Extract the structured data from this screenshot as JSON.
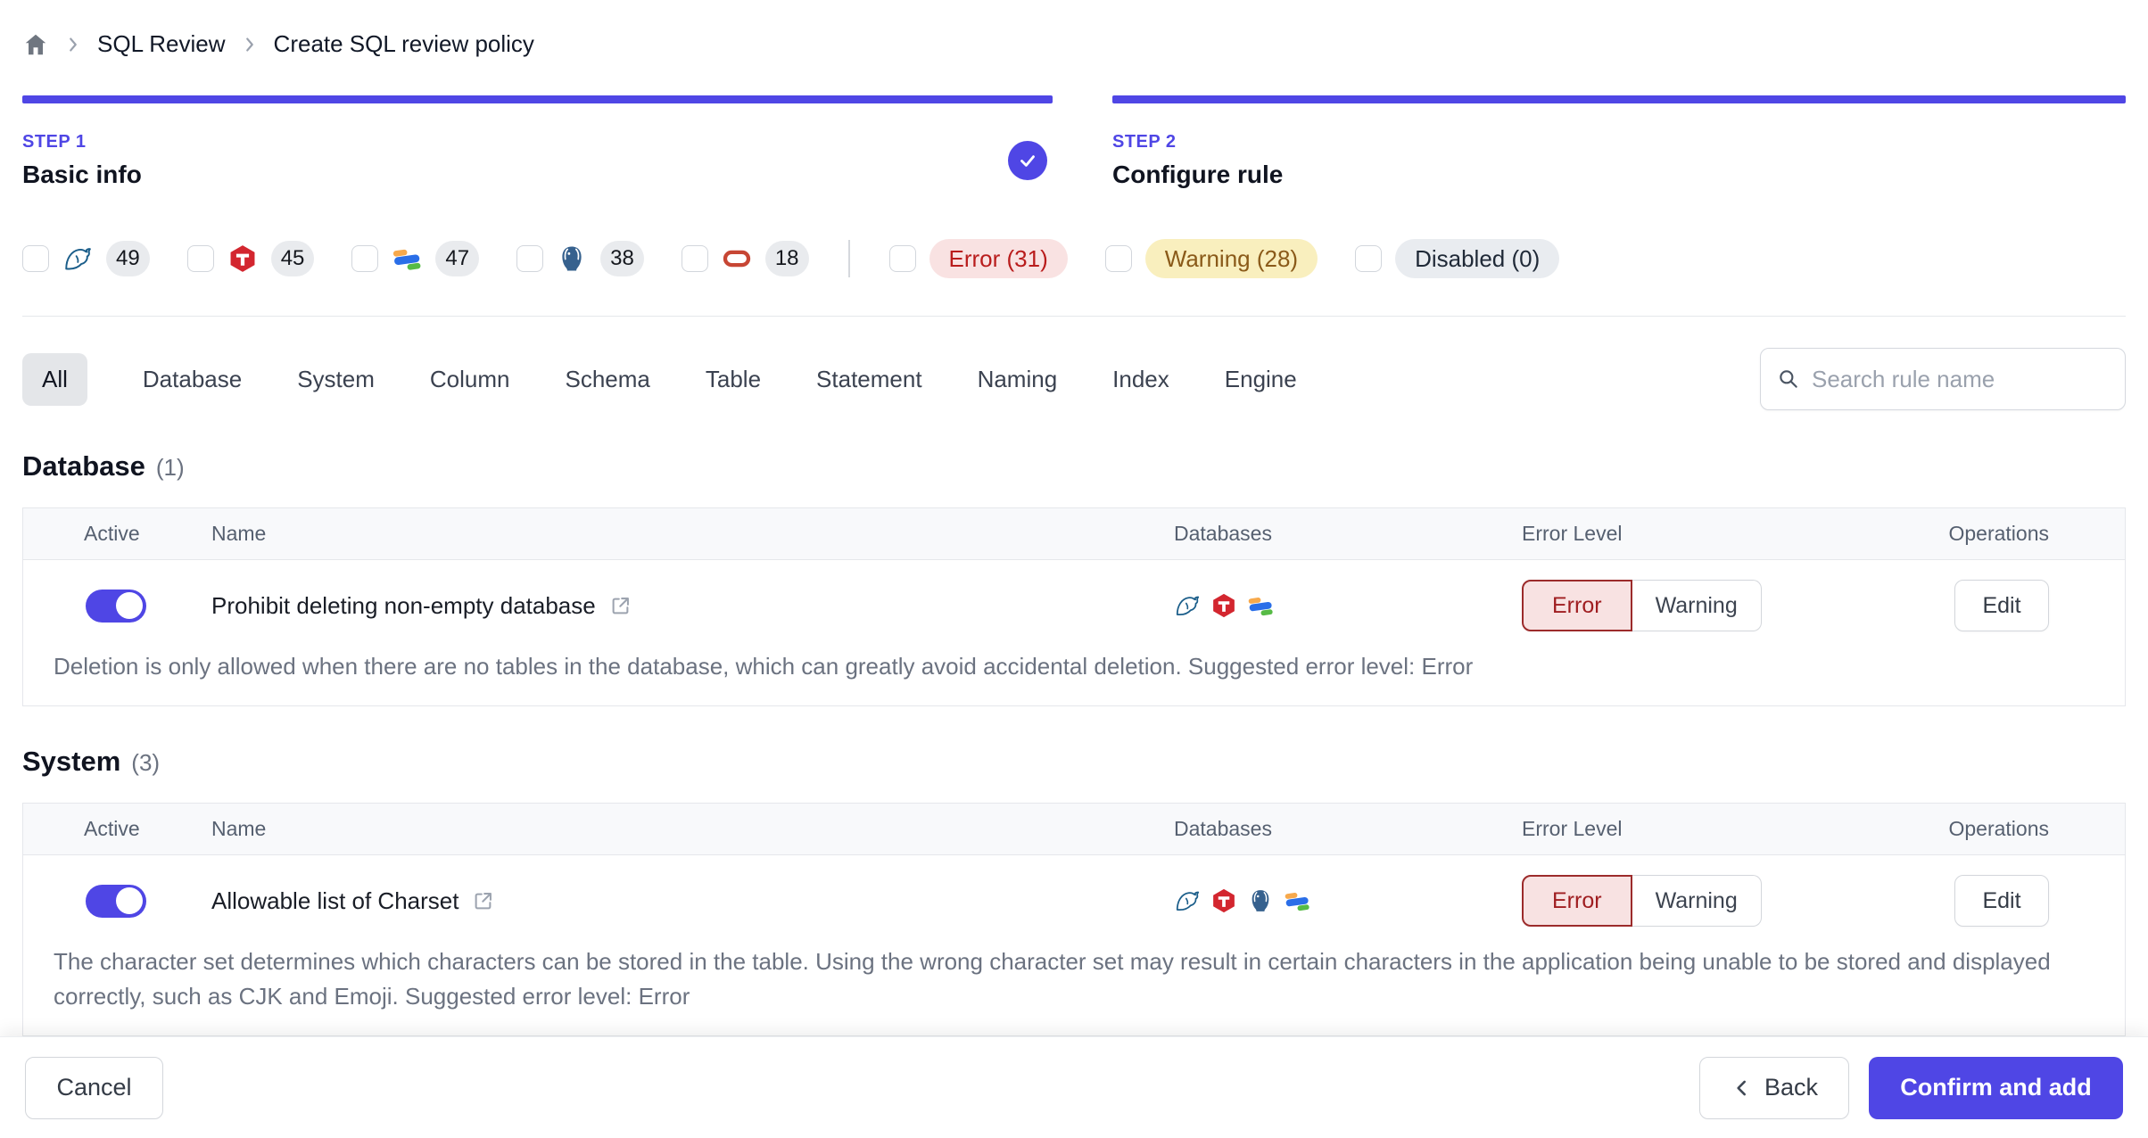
{
  "colors": {
    "accent": "#4f46e5",
    "error_text": "#9f1d20",
    "error_bg": "#f8e2e2",
    "warning_text": "#8a5a19",
    "warning_bg": "#f9efbe",
    "disabled_bg": "#e9ecf0"
  },
  "breadcrumb": {
    "home_icon": "home-icon",
    "items": [
      "SQL Review",
      "Create SQL review policy"
    ]
  },
  "steps": [
    {
      "label": "STEP 1",
      "title": "Basic info",
      "completed": true
    },
    {
      "label": "STEP 2",
      "title": "Configure rule",
      "completed": false
    }
  ],
  "filters": {
    "engines": [
      {
        "icon": "mysql",
        "count": "49"
      },
      {
        "icon": "tidb",
        "count": "45"
      },
      {
        "icon": "oceanbase",
        "count": "47"
      },
      {
        "icon": "postgres",
        "count": "38"
      },
      {
        "icon": "oracle",
        "count": "18"
      }
    ],
    "levels": [
      {
        "label": "Error (31)"
      },
      {
        "label": "Warning (28)"
      },
      {
        "label": "Disabled (0)"
      }
    ]
  },
  "tabs": [
    "All",
    "Database",
    "System",
    "Column",
    "Schema",
    "Table",
    "Statement",
    "Naming",
    "Index",
    "Engine"
  ],
  "search": {
    "placeholder": "Search rule name",
    "icon": "search-icon"
  },
  "sections": [
    {
      "title": "Database",
      "count": "(1)",
      "columns": [
        "Active",
        "Name",
        "Databases",
        "Error Level",
        "Operations"
      ],
      "rows": [
        {
          "name": "Prohibit deleting non-empty database",
          "active": true,
          "databases": [
            "mysql",
            "tidb",
            "oceanbase"
          ],
          "level_selected": "Error",
          "level_options": [
            "Error",
            "Warning"
          ],
          "operation": "Edit",
          "description": "Deletion is only allowed when there are no tables in the database, which can greatly avoid accidental deletion. Suggested error level: Error"
        }
      ]
    },
    {
      "title": "System",
      "count": "(3)",
      "columns": [
        "Active",
        "Name",
        "Databases",
        "Error Level",
        "Operations"
      ],
      "rows": [
        {
          "name": "Allowable list of Charset",
          "active": true,
          "databases": [
            "mysql",
            "tidb",
            "postgres",
            "oceanbase"
          ],
          "level_selected": "Error",
          "level_options": [
            "Error",
            "Warning"
          ],
          "operation": "Edit",
          "description": "The character set determines which characters can be stored in the table. Using the wrong character set may result in certain characters in the application being unable to be stored and displayed correctly, such as CJK and Emoji. Suggested error level: Error"
        }
      ]
    }
  ],
  "footer": {
    "cancel": "Cancel",
    "back": "Back",
    "confirm": "Confirm and add"
  }
}
